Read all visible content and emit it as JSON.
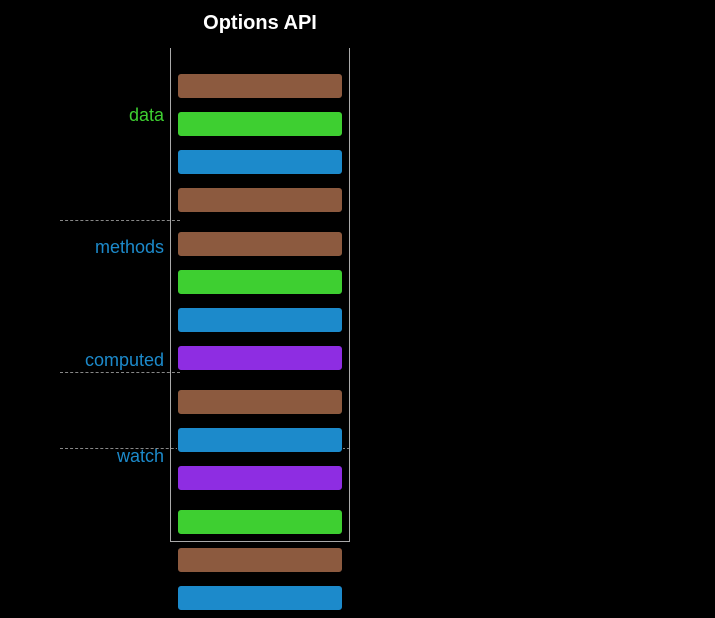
{
  "title": "Options API",
  "sections": {
    "data": {
      "label": "data",
      "color": "#3ecf31"
    },
    "methods": {
      "label": "methods",
      "color": "#1c8acb"
    },
    "computed": {
      "label": "computed",
      "color": "#1c8acb"
    },
    "watch": {
      "label": "watch",
      "color": "#1c8acb"
    }
  },
  "chart_data": {
    "type": "bar",
    "title": "Options API",
    "categories": [
      "data",
      "methods",
      "computed",
      "watch"
    ],
    "series": [
      {
        "name": "data",
        "bars": [
          "brown",
          "green",
          "blue",
          "brown"
        ]
      },
      {
        "name": "methods",
        "bars": [
          "brown",
          "green",
          "blue",
          "purple"
        ]
      },
      {
        "name": "computed",
        "bars": [
          "brown",
          "blue",
          "purple"
        ]
      },
      {
        "name": "watch",
        "bars": [
          "green",
          "brown",
          "blue"
        ]
      }
    ],
    "palette": {
      "brown": "#8c5a3f",
      "green": "#3ecf31",
      "blue": "#1c8acb",
      "purple": "#8e2de2"
    }
  }
}
